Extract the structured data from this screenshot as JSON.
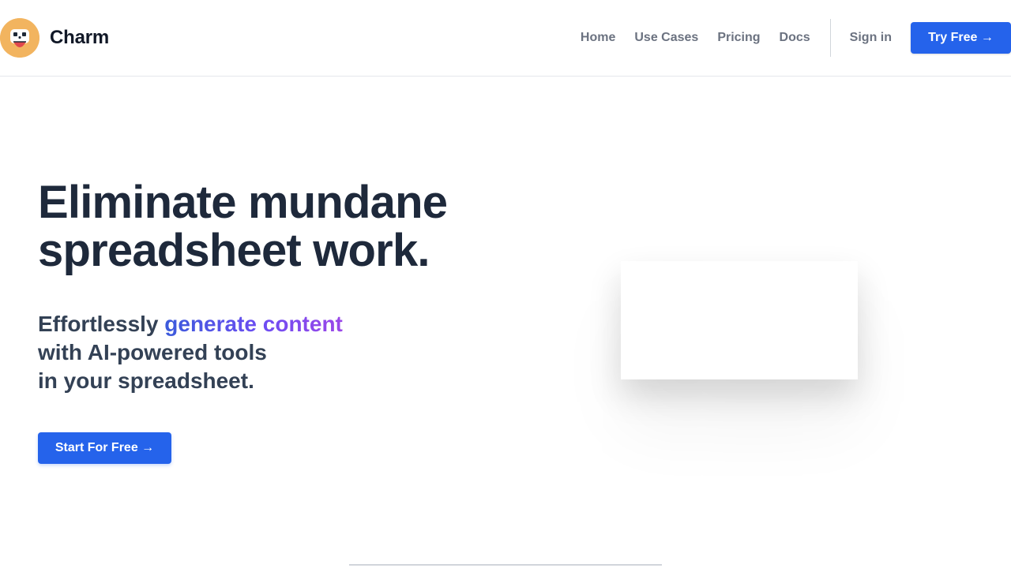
{
  "brand": {
    "name": "Charm",
    "logo_icon": "charm-mascot-icon",
    "logo_color": "#f2b45f"
  },
  "nav": {
    "items": [
      {
        "label": "Home"
      },
      {
        "label": "Use Cases"
      },
      {
        "label": "Pricing"
      },
      {
        "label": "Docs"
      }
    ],
    "sign_in": "Sign in",
    "try_free": "Try Free →"
  },
  "hero": {
    "title_line1": "Eliminate mundane",
    "title_line2": "spreadsheet work.",
    "subtitle_prefix": "Effortlessly ",
    "subtitle_highlight": "generate content",
    "subtitle_line2": "with AI-powered tools",
    "subtitle_line3": "in your spreadsheet.",
    "cta": "Start For Free →"
  },
  "colors": {
    "accent": "#2563eb",
    "heading": "#1e293b",
    "nav_text": "#6b7280"
  }
}
